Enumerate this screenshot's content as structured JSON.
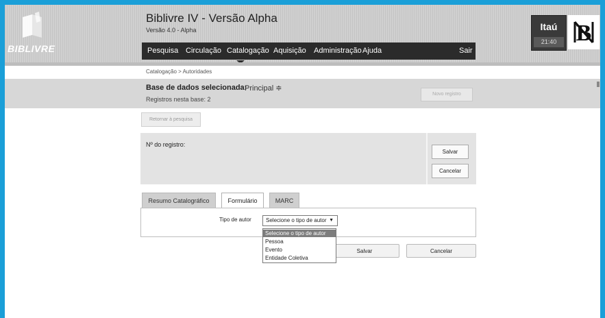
{
  "header": {
    "logo_text": "BIBLIVRE",
    "app_title": "Biblivre IV - Versão Alpha",
    "app_version": "Versão 4.0 - Alpha",
    "menu": [
      {
        "label": "Pesquisa"
      },
      {
        "label": "Circulação"
      },
      {
        "label": "Catalogação"
      },
      {
        "label": "Aquisição"
      },
      {
        "label": "Administração"
      },
      {
        "label": "Ajuda"
      }
    ],
    "logout": "Sair",
    "bank_name": "Itaú",
    "clock": "21:40"
  },
  "breadcrumb": "Catalogação > Autoridades",
  "database": {
    "label": "Base de dados selecionada:",
    "value": "Principal ≑",
    "count": "Registros nesta base: 2",
    "new_record": "Novo registro"
  },
  "return_button": "Retornar à pesquisa",
  "record": {
    "label": "Nº do registro:",
    "save": "Salvar",
    "cancel": "Cancelar"
  },
  "tabs": [
    {
      "label": "Resumo Catalográfico"
    },
    {
      "label": "Formulário"
    },
    {
      "label": "MARC"
    }
  ],
  "form": {
    "author_type_label": "Tipo de autor",
    "author_type_value": "Selecione o tipo de autor",
    "author_type_options": [
      "Selecione o tipo de autor",
      "Pessoa",
      "Evento",
      "Entidade Coletiva"
    ],
    "save": "Salvar",
    "cancel": "Cancelar"
  },
  "colors": {
    "frame_border": "#1a9fd8",
    "menubar": "#2b2b2b",
    "band": "#d7d7d7"
  }
}
